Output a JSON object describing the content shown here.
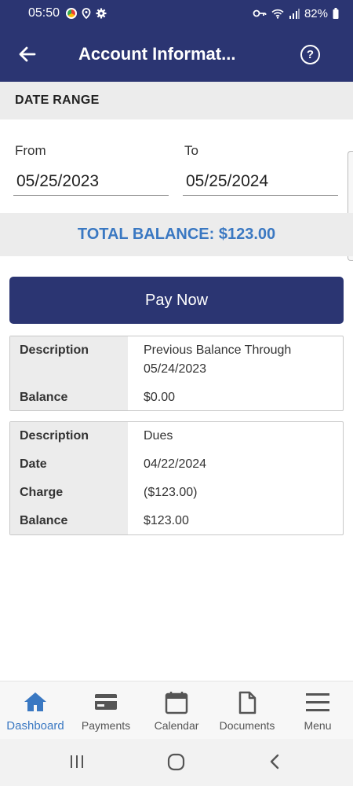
{
  "status_bar": {
    "time": "05:50",
    "battery": "82%"
  },
  "app_bar": {
    "title": "Account Informat...",
    "help_symbol": "?"
  },
  "date_range": {
    "header": "DATE RANGE",
    "from_label": "From",
    "from_value": "05/25/2023",
    "to_label": "To",
    "to_value": "05/25/2024"
  },
  "total_balance": "TOTAL BALANCE: $123.00",
  "pay_button": "Pay Now",
  "entries": [
    {
      "description_label": "Description",
      "description": "Previous Balance Through 05/24/2023",
      "balance_label": "Balance",
      "balance": "$0.00"
    },
    {
      "description_label": "Description",
      "description": "Dues",
      "date_label": "Date",
      "date": "04/22/2024",
      "charge_label": "Charge",
      "charge": "($123.00)",
      "balance_label": "Balance",
      "balance": "$123.00"
    }
  ],
  "bottom_nav": [
    {
      "label": "Dashboard",
      "icon": "home-icon",
      "active": true
    },
    {
      "label": "Payments",
      "icon": "credit-card-icon"
    },
    {
      "label": "Calendar",
      "icon": "calendar-icon"
    },
    {
      "label": "Documents",
      "icon": "document-icon"
    },
    {
      "label": "Menu",
      "icon": "hamburger-menu-icon"
    }
  ],
  "colors": {
    "primary": "#2b3572",
    "accent": "#3a78c2",
    "panel": "#ececec"
  }
}
